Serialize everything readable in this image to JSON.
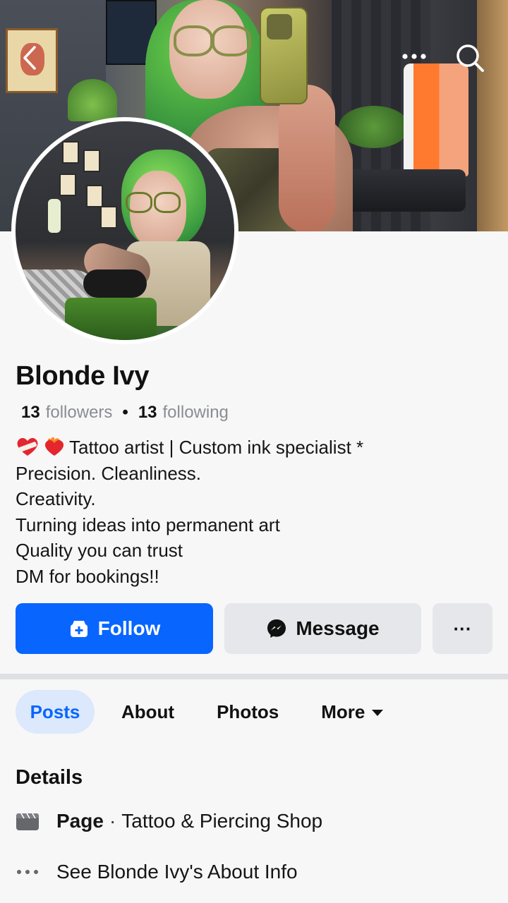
{
  "header": {
    "back_icon": "chevron-left-icon",
    "more_icon": "ellipsis-icon",
    "search_icon": "search-icon"
  },
  "profile": {
    "name": "Blonde Ivy",
    "followers_count": "13",
    "followers_label": "followers",
    "following_count": "13",
    "following_label": "following",
    "bio_emojis": [
      "red-heart-with-bandage-emoji",
      "heart-on-fire-emoji"
    ],
    "bio_lines": [
      "Tattoo artist | Custom ink specialist *",
      "Precision. Cleanliness.",
      "Creativity.",
      "Turning ideas into permanent art",
      "Quality you can trust",
      "DM for bookings!!"
    ]
  },
  "actions": {
    "follow_label": "Follow",
    "message_label": "Message",
    "more_label": "···"
  },
  "tabs": [
    {
      "label": "Posts",
      "active": true
    },
    {
      "label": "About",
      "active": false
    },
    {
      "label": "Photos",
      "active": false
    },
    {
      "label": "More",
      "active": false
    }
  ],
  "details": {
    "heading": "Details",
    "page_type_label": "Page",
    "page_category": "Tattoo & Piercing Shop",
    "about_link": "See Blonde Ivy's About Info"
  },
  "colors": {
    "primary": "#0866ff",
    "tab_active_bg": "#dce8fb",
    "button_secondary_bg": "#e6e7eb",
    "page_bg": "#f7f7f8"
  }
}
